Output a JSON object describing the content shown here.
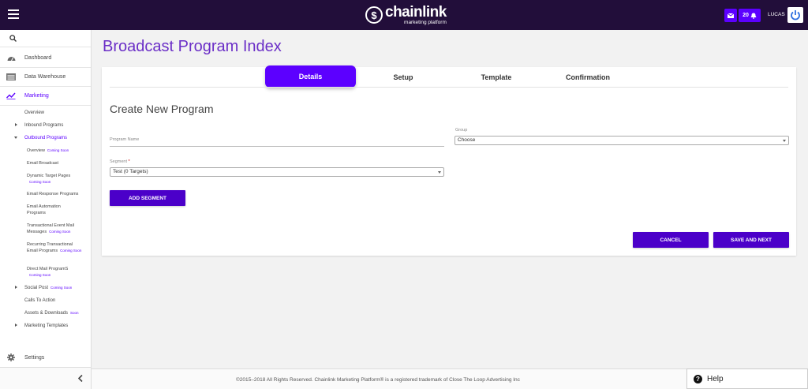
{
  "topbar": {
    "logo_name": "chainlink",
    "logo_sub": "marketing platform",
    "notif_count": "20",
    "user": "LUCAS"
  },
  "sidebar": {
    "main_items": [
      {
        "label": "Dashboard",
        "icon": "dashboard-icon"
      },
      {
        "label": "Data Warehouse",
        "icon": "warehouse-icon"
      },
      {
        "label": "Marketing",
        "icon": "chart-line-icon"
      }
    ],
    "marketing_sub": {
      "overview": "Overview",
      "inbound": "Inbound Programs",
      "outbound": "Outbound Programs",
      "out_overview": "Overview",
      "email_broadcast": "Email Broadcast",
      "dynamic_target": "Dynamic Target Pages",
      "email_response": "Email Response Programs",
      "email_automation": "Email Automation Programs",
      "transactional": "Transactional Event Mail Messages",
      "recurring": "Recurring Transactional Email Programs",
      "direct_mail": "Direct Mail ProgramS",
      "social_post": "Social Post",
      "calls_to_action": "Calls To Action",
      "assets_downloads": "Assets & Downloads",
      "marketing_templates": "Marketing Templates"
    },
    "coming_soon": "Coming Soon",
    "soon": "Soon",
    "settings": "Settings"
  },
  "main": {
    "title": "Broadcast Program Index",
    "tabs": [
      "Details",
      "Setup",
      "Template",
      "Confirmation"
    ],
    "form_title": "Create New Program",
    "program_name_label": "Program Name",
    "group_label": "Group",
    "group_value": "Choose",
    "segment_label": "Segment",
    "segment_required": "*",
    "segment_value": "Test (0 Targets)",
    "add_segment": "ADD SEGMENT",
    "cancel": "CANCEL",
    "save_next": "SAVE AND NEXT"
  },
  "footer": {
    "text": "©2015–2018 All Rights Reserved. Chainlink Marketing Platform® is a registered trademark of Close The Loop Advertising Inc"
  },
  "help": {
    "label": "Help"
  },
  "colors": {
    "topbar": "#220e3a",
    "accent": "#5c00ff",
    "button": "#4b00c9",
    "title": "#6b2fc7"
  }
}
